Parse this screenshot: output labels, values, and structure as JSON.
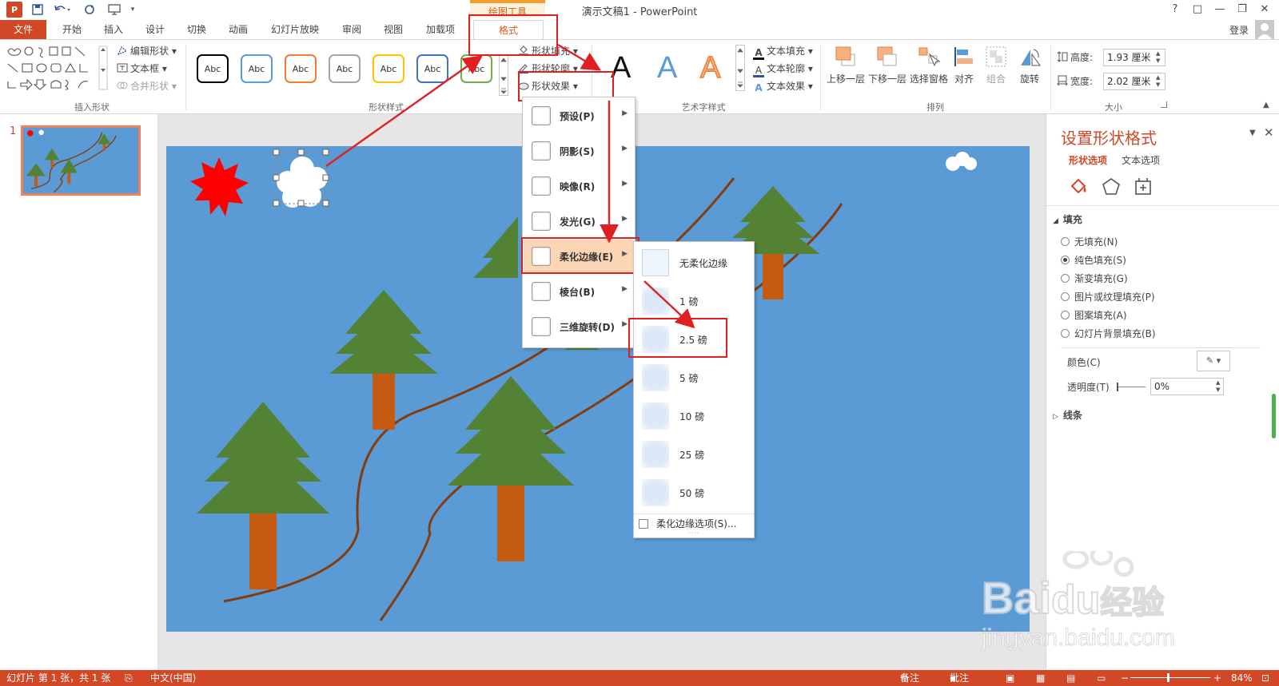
{
  "title_bar": {
    "window_title": "演示文稿1 - PowerPoint",
    "app_logo": "P",
    "contextual_group": "绘图工具",
    "help": "?",
    "ribbon_display": "□",
    "minimize": "—",
    "restore": "❐",
    "close": "✕"
  },
  "tabs": {
    "file": "文件",
    "home": "开始",
    "insert": "插入",
    "design": "设计",
    "transitions": "切换",
    "animations": "动画",
    "slideshow": "幻灯片放映",
    "review": "审阅",
    "view": "视图",
    "addins": "加载项",
    "format": "格式",
    "login": "登录"
  },
  "ribbon": {
    "insert_shapes": {
      "label": "插入形状",
      "edit_shape": "编辑形状",
      "text_box": "文本框",
      "merge_shapes": "合并形状"
    },
    "shape_styles": {
      "label": "形状样式",
      "swatch_text": "Abc",
      "swatch_colors": [
        "#000000",
        "#5b9bd5",
        "#ed7d31",
        "#a5a5a5",
        "#ffc000",
        "#4472c4",
        "#70ad47"
      ],
      "shape_fill": "形状填充",
      "shape_outline": "形状轮廓",
      "shape_effects": "形状效果"
    },
    "wordart": {
      "label": "艺术字样式",
      "letter": "A",
      "text_fill": "文本填充",
      "text_outline": "文本轮廓",
      "text_effects": "文本效果"
    },
    "arrange": {
      "label": "排列",
      "bring_forward": "上移一层",
      "send_backward": "下移一层",
      "selection_pane": "选择窗格",
      "align": "对齐",
      "group": "组合",
      "rotate": "旋转"
    },
    "size": {
      "label": "大小",
      "height_label": "高度:",
      "height_value": "1.93 厘米",
      "width_label": "宽度:",
      "width_value": "2.02 厘米"
    }
  },
  "thumbnail_pane": {
    "slide_number": "1"
  },
  "effects_menu": {
    "items": [
      {
        "label": "预设(P)"
      },
      {
        "label": "阴影(S)"
      },
      {
        "label": "映像(R)"
      },
      {
        "label": "发光(G)"
      },
      {
        "label": "柔化边缘(E)"
      },
      {
        "label": "棱台(B)"
      },
      {
        "label": "三维旋转(D)"
      }
    ]
  },
  "soft_edges_menu": {
    "items": [
      {
        "label": "无柔化边缘"
      },
      {
        "label": "1 磅"
      },
      {
        "label": "2.5 磅"
      },
      {
        "label": "5 磅"
      },
      {
        "label": "10 磅"
      },
      {
        "label": "25 磅"
      },
      {
        "label": "50 磅"
      }
    ],
    "options": "柔化边缘选项(S)..."
  },
  "format_pane": {
    "title": "设置形状格式",
    "tab_shape": "形状选项",
    "tab_text": "文本选项",
    "fill_section": "填充",
    "fill_options": [
      {
        "label": "无填充(N)",
        "checked": false
      },
      {
        "label": "纯色填充(S)",
        "checked": true
      },
      {
        "label": "渐变填充(G)",
        "checked": false
      },
      {
        "label": "图片或纹理填充(P)",
        "checked": false
      },
      {
        "label": "图案填充(A)",
        "checked": false
      },
      {
        "label": "幻灯片背景填充(B)",
        "checked": false
      }
    ],
    "color_label": "颜色(C)",
    "transparency_label": "透明度(T)",
    "transparency_value": "0%",
    "line_section": "线条"
  },
  "status_bar": {
    "slide_info": "幻灯片 第 1 张，共 1 张",
    "language": "中文(中国)",
    "notes": "备注",
    "comments": "批注",
    "zoom": "84%"
  },
  "watermark": {
    "brand": "Bai",
    "brand_cn": "经验",
    "url": "jingyan.baidu.com"
  },
  "colors": {
    "accent": "#d24726",
    "slide_bg": "#5b9bd5",
    "tree_green": "#548235",
    "trunk": "#c55a11",
    "sun": "#ff0000",
    "path": "#843c0c",
    "annotation": "#e02020"
  }
}
